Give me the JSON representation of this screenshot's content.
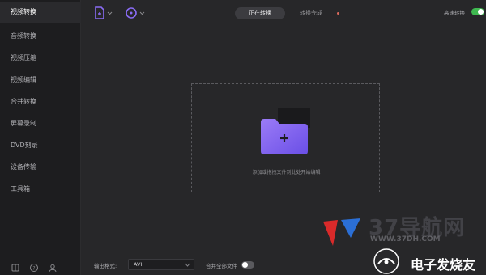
{
  "sidebar": {
    "items": [
      {
        "label": "视频转换",
        "active": true
      },
      {
        "label": "音频转换"
      },
      {
        "label": "视频压缩"
      },
      {
        "label": "视频编辑"
      },
      {
        "label": "合并转换"
      },
      {
        "label": "屏幕录制"
      },
      {
        "label": "DVD刻录"
      },
      {
        "label": "设备传输"
      },
      {
        "label": "工具箱"
      }
    ],
    "footer_icons": [
      "book-icon",
      "help-icon",
      "user-icon"
    ]
  },
  "toolbar": {
    "add_file_icon": "add-file-icon",
    "add_url_icon": "add-disc-icon",
    "tabs": [
      {
        "label": "正在转换",
        "active": true
      },
      {
        "label": "转换完成"
      }
    ],
    "speed_label": "高速转换",
    "speed_enabled": true
  },
  "dropzone": {
    "hint": "添加或拖拽文件到此处开始编辑",
    "icon": "folder-plus-icon"
  },
  "bottombar": {
    "output_label": "输出格式:",
    "format_value": "AVI",
    "merge_label": "合并全部文件",
    "merge_enabled": false
  },
  "watermark": {
    "title": "37导航网",
    "url": "WWW.37DH.COM",
    "badge": "电子发烧友"
  },
  "colors": {
    "accent": "#7a5cf0",
    "toggle_on": "#3fb950",
    "tab_dot": "#d96a5c"
  }
}
